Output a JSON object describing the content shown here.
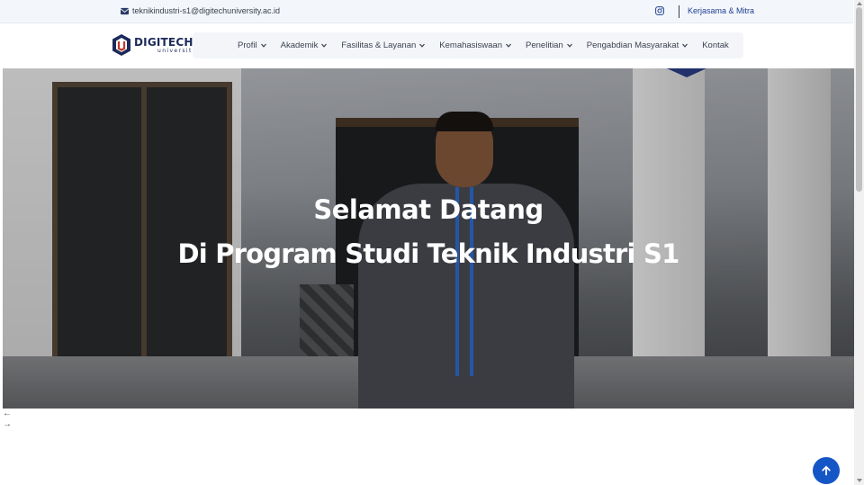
{
  "topbar": {
    "email": "teknikindustri-s1@digitechuniversity.ac.id",
    "email_icon": "envelope-icon",
    "social_icon": "instagram-icon",
    "partner_link": "Kerjasama & Mitra"
  },
  "logo": {
    "brand": "DIGITECH",
    "sub": "university"
  },
  "nav": {
    "items": [
      {
        "label": "Profil",
        "has_dropdown": true
      },
      {
        "label": "Akademik",
        "has_dropdown": true
      },
      {
        "label": "Fasilitas & Layanan",
        "has_dropdown": true
      },
      {
        "label": "Kemahasiswaan",
        "has_dropdown": true
      },
      {
        "label": "Penelitian",
        "has_dropdown": true
      },
      {
        "label": "Pengabdian Masyarakat",
        "has_dropdown": true
      },
      {
        "label": "Kontak",
        "has_dropdown": false
      }
    ]
  },
  "hero": {
    "line1": "Selamat Datang",
    "line2": "Di Program Studi Teknik Industri S1"
  },
  "slider": {
    "prev_icon": "arrow-left-icon",
    "next_icon": "arrow-right-icon"
  },
  "back_to_top_icon": "arrow-up-icon",
  "colors": {
    "accent": "#1556c6",
    "brand_navy": "#1b2a5a",
    "topbar_bg": "#f3f6fb",
    "nav_bg": "#f3f5f9"
  }
}
